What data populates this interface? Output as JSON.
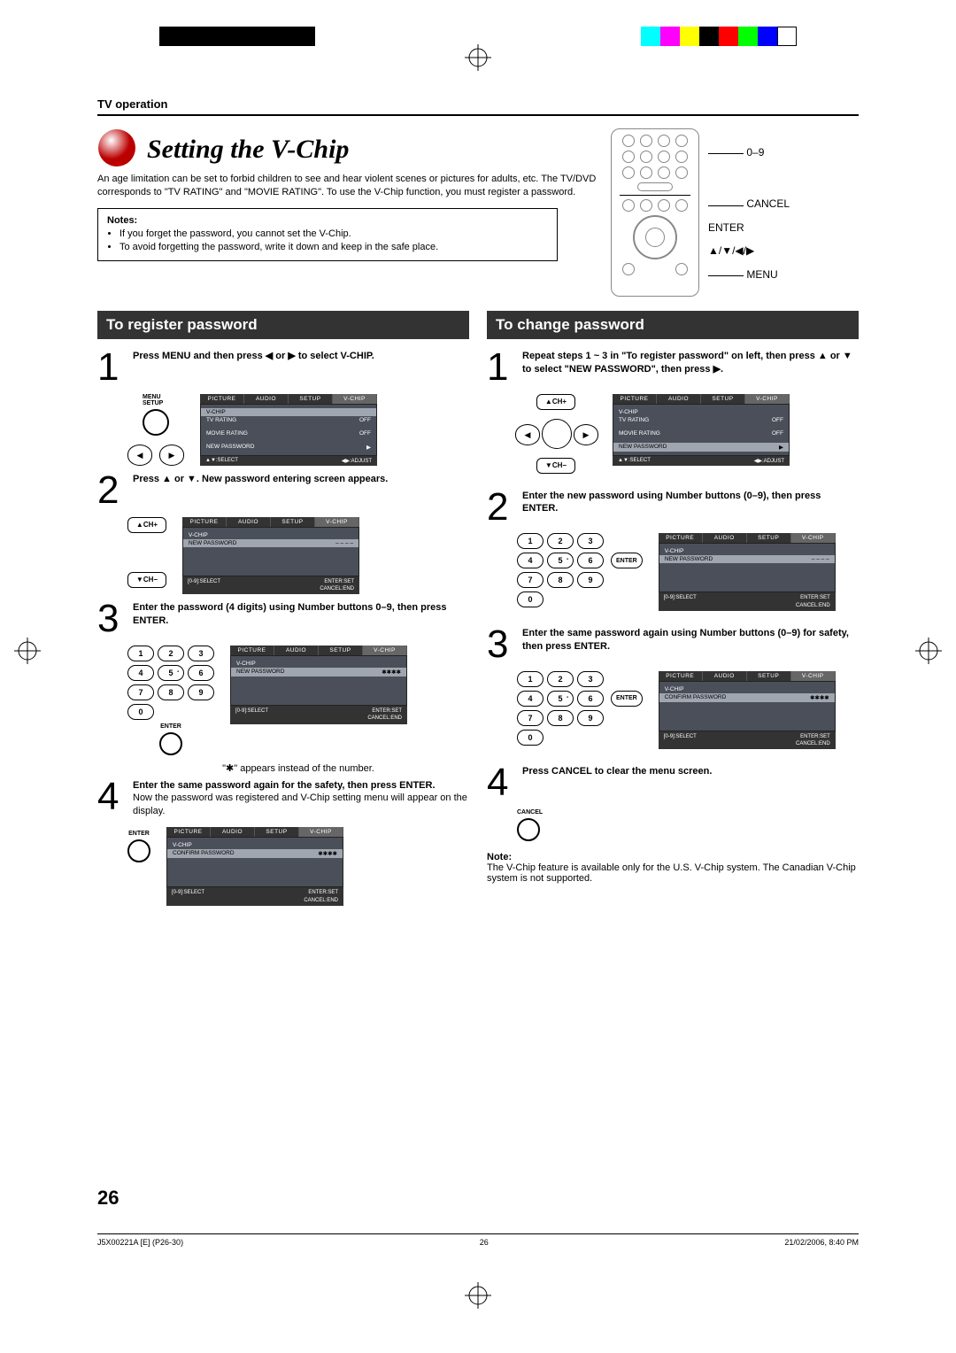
{
  "header": {
    "section": "TV operation"
  },
  "title": "Setting the V-Chip",
  "intro": "An age limitation can be set to forbid children to see and hear violent scenes or pictures for adults, etc. The TV/DVD corresponds to \"TV RATING\" and \"MOVIE RATING\". To use the V-Chip function, you must register a password.",
  "notes": {
    "title": "Notes:",
    "items": [
      "If you forget the password, you cannot set the V-Chip.",
      "To avoid forgetting the password, write it down and keep in the safe place."
    ]
  },
  "remote_labels": {
    "numbers": "0–9",
    "cancel": "CANCEL",
    "enter": "ENTER",
    "arrows": "▲/▼/◀/▶",
    "menu": "MENU"
  },
  "left": {
    "heading": "To register password",
    "step1": {
      "title": "Press MENU and then press ◀ or ▶ to select V-CHIP.",
      "btn_label": "MENU\nSETUP"
    },
    "step2": {
      "title": "Press ▲ or ▼. New password entering screen appears."
    },
    "step3": {
      "title": "Enter the password (4 digits) using Number buttons 0–9, then press ENTER.",
      "note": "\"✱\" appears instead of the number."
    },
    "step4": {
      "title": "Enter the same password again for the safety, then press ENTER.",
      "text": "Now the password was registered and V-Chip setting menu will appear on the display."
    }
  },
  "right": {
    "heading": "To change password",
    "step1": {
      "title": "Repeat steps 1 ~ 3 in \"To register password\" on left, then press ▲ or ▼ to select \"NEW PASSWORD\", then press ▶."
    },
    "step2": {
      "title": "Enter the new password using Number buttons (0–9), then press ENTER."
    },
    "step3": {
      "title": "Enter the same password again using Number buttons (0–9) for safety, then press ENTER."
    },
    "step4": {
      "title": "Press CANCEL to clear the menu screen."
    },
    "note": {
      "title": "Note:",
      "text": "The V-Chip feature is available only for the U.S. V-Chip system. The Canadian V-Chip system is not supported."
    }
  },
  "osd": {
    "tabs": [
      "PICTURE",
      "AUDIO",
      "SETUP",
      "V-CHIP"
    ],
    "rows_vchip": [
      {
        "label": "V-CHIP",
        "val": ""
      },
      {
        "label": "TV RATING",
        "val": "OFF"
      },
      {
        "label": "MOVIE RATING",
        "val": "OFF"
      },
      {
        "label": "NEW PASSWORD",
        "val": "▶"
      }
    ],
    "row_vchip_only": "V-CHIP",
    "row_vchip_off": "OFF",
    "row_newpw": "NEW PASSWORD",
    "row_confirmpw": "CONFIRM PASSWORD",
    "masked": "✱✱✱✱",
    "foot_select": "▲▼:SELECT",
    "foot_adjust": "◀▶:ADJUST",
    "foot_09": "[0-9]:SELECT",
    "foot_enter": "ENTER:SET",
    "foot_cancel": "CANCEL:END"
  },
  "buttons": {
    "enter": "ENTER",
    "cancel": "CANCEL",
    "chplus": "▲CH+",
    "chminus": "▼CH−"
  },
  "keypad": [
    "1",
    "2",
    "3",
    "4",
    "5",
    "6",
    "7",
    "8",
    "9",
    "0"
  ],
  "page_number": "26",
  "footer": {
    "file": "J5X00221A [E] (P26-30)",
    "page": "26",
    "date": "21/02/2006, 8:40 PM"
  }
}
